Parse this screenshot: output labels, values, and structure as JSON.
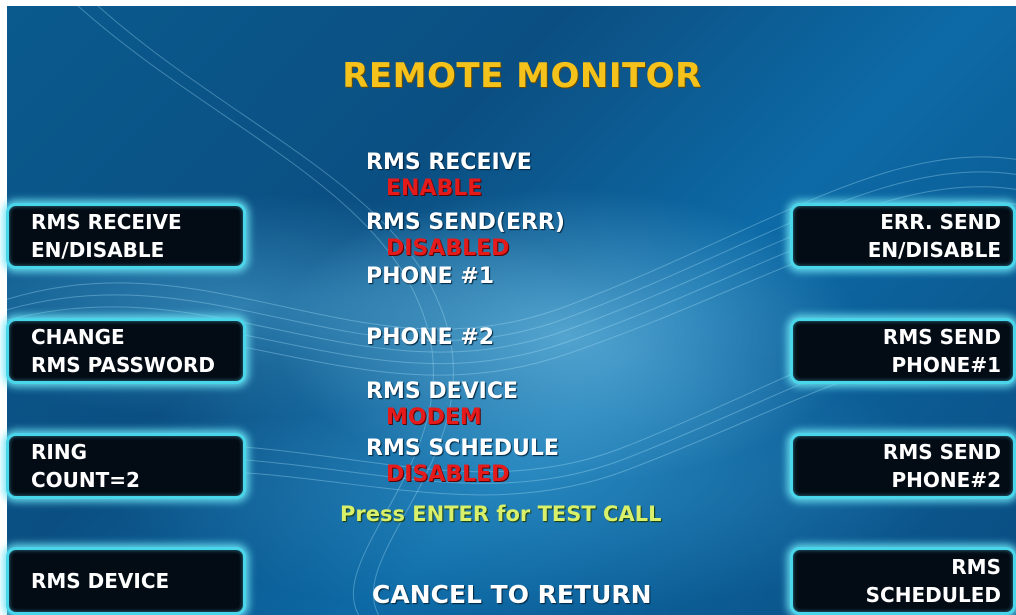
{
  "title": "REMOTE MONITOR",
  "left_buttons": [
    {
      "line1": "RMS RECEIVE",
      "line2": "EN/DISABLE"
    },
    {
      "line1": "CHANGE",
      "line2": "RMS PASSWORD"
    },
    {
      "line1": "RING",
      "line2": "COUNT=2"
    },
    {
      "line1": "RMS DEVICE",
      "line2": ""
    }
  ],
  "right_buttons": [
    {
      "line1": "ERR. SEND",
      "line2": "EN/DISABLE"
    },
    {
      "line1": "RMS SEND",
      "line2": "PHONE#1"
    },
    {
      "line1": "RMS SEND",
      "line2": "PHONE#2"
    },
    {
      "line1": "RMS",
      "line2": "SCHEDULED"
    }
  ],
  "settings": [
    {
      "label": "RMS RECEIVE",
      "value": "ENABLE"
    },
    {
      "label": "RMS SEND(ERR)",
      "value": "DISABLED"
    },
    {
      "label": "PHONE #1",
      "value": ""
    },
    {
      "label": "PHONE #2",
      "value": ""
    },
    {
      "label": "RMS DEVICE",
      "value": "MODEM"
    },
    {
      "label": "RMS SCHEDULE",
      "value": "DISABLED"
    }
  ],
  "hint": "Press ENTER for TEST CALL",
  "cancel": "CANCEL TO RETURN",
  "colors": {
    "title": "#f4c21b",
    "value": "#e51a1a",
    "hint": "#d8f06a",
    "button_border": "#49d6ea",
    "background": "#0b4f82"
  }
}
